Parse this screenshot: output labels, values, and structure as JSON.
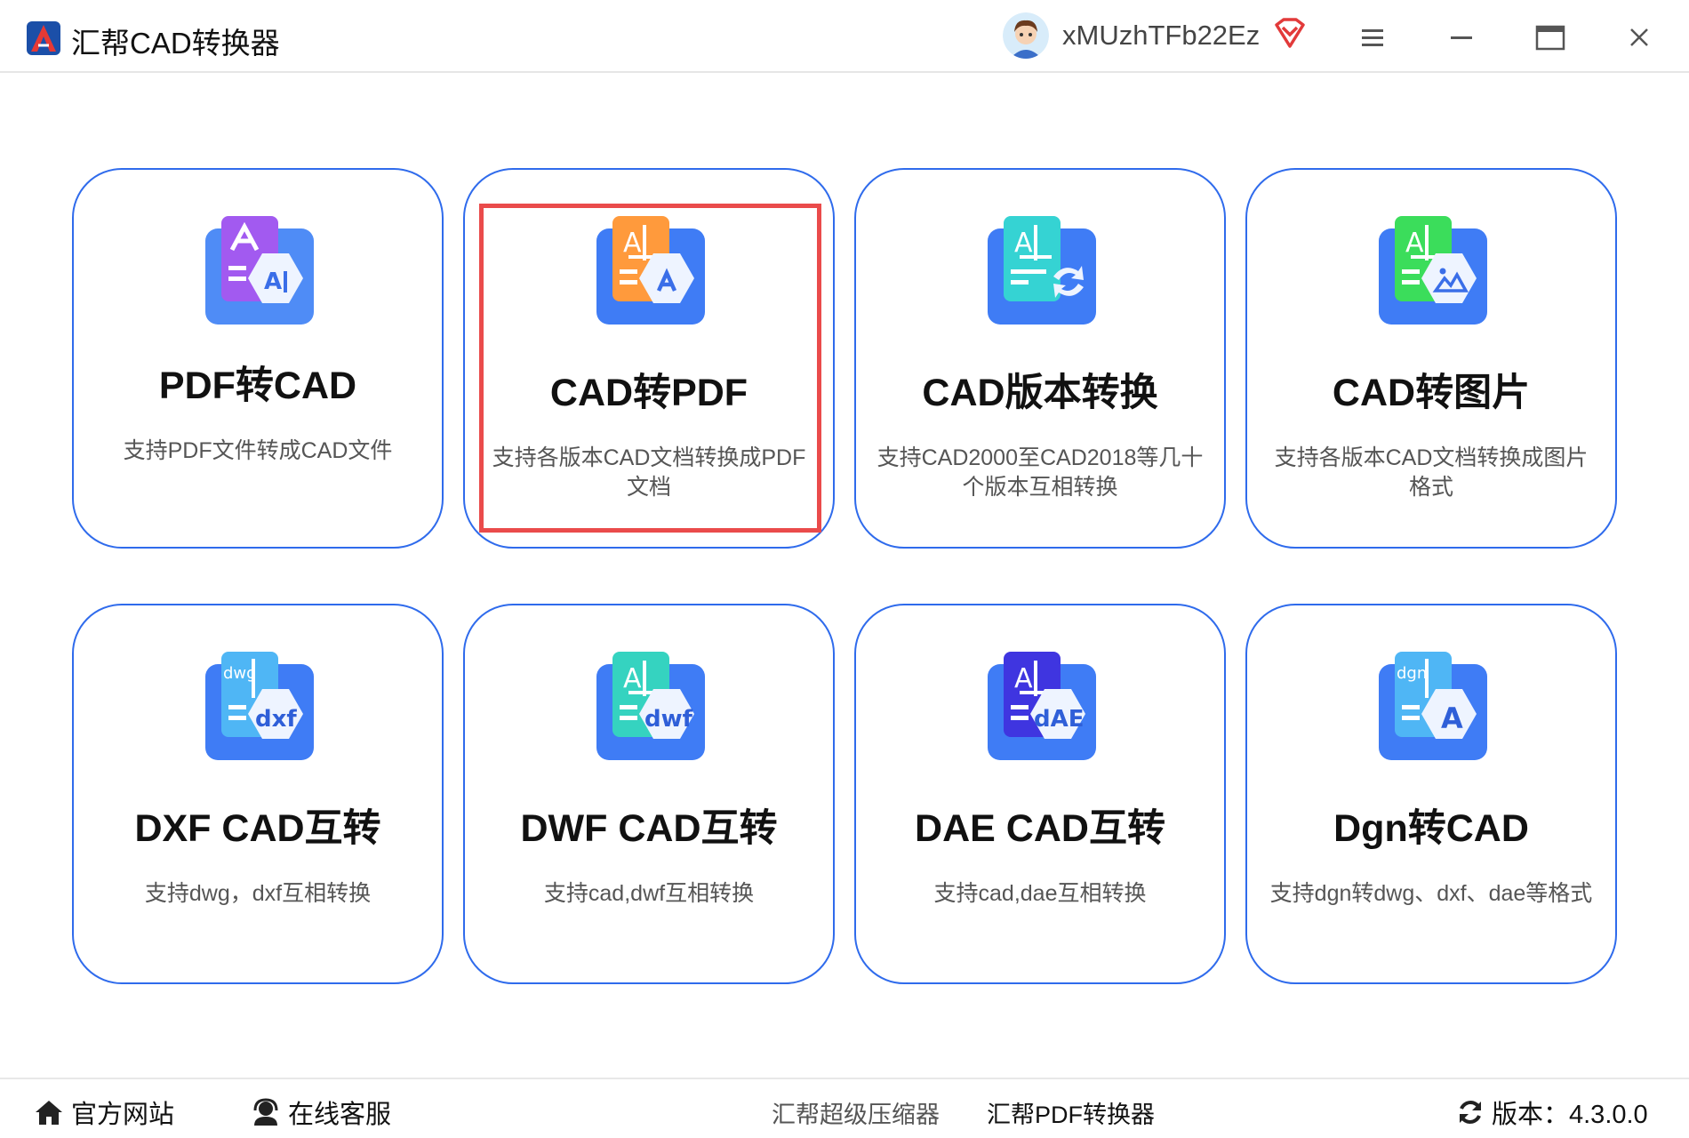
{
  "app": {
    "title": "汇帮CAD转换器",
    "username": "xMUzhTFb22Ez"
  },
  "colors": {
    "accent": "#2f6bec",
    "highlight": "#ea4b4b"
  },
  "cards": [
    {
      "title": "PDF转CAD",
      "desc": "支持PDF文件转成CAD文件",
      "icon": "pdf-to-cad-icon"
    },
    {
      "title": "CAD转PDF",
      "desc": "支持各版本CAD文档转换成PDF文档",
      "icon": "cad-to-pdf-icon"
    },
    {
      "title": "CAD版本转换",
      "desc": "支持CAD2000至CAD2018等几十个版本互相转换",
      "icon": "cad-version-convert-icon"
    },
    {
      "title": "CAD转图片",
      "desc": "支持各版本CAD文档转换成图片格式",
      "icon": "cad-to-image-icon"
    },
    {
      "title": "DXF CAD互转",
      "desc": "支持dwg，dxf互相转换",
      "icon": "dxf-cad-icon",
      "badge": "dxf",
      "top": "dwg"
    },
    {
      "title": "DWF CAD互转",
      "desc": "支持cad,dwf互相转换",
      "icon": "dwf-cad-icon",
      "badge": "dwf"
    },
    {
      "title": "DAE CAD互转",
      "desc": "支持cad,dae互相转换",
      "icon": "dae-cad-icon",
      "badge": "dAE"
    },
    {
      "title": "Dgn转CAD",
      "desc": "支持dgn转dwg、dxf、dae等格式",
      "icon": "dgn-to-cad-icon",
      "badge": "A",
      "top": "dgn"
    }
  ],
  "footer": {
    "website": "官方网站",
    "support": "在线客服",
    "compressor": "汇帮超级压缩器",
    "pdf_converter": "汇帮PDF转换器",
    "version": "版本：4.3.0.0"
  }
}
